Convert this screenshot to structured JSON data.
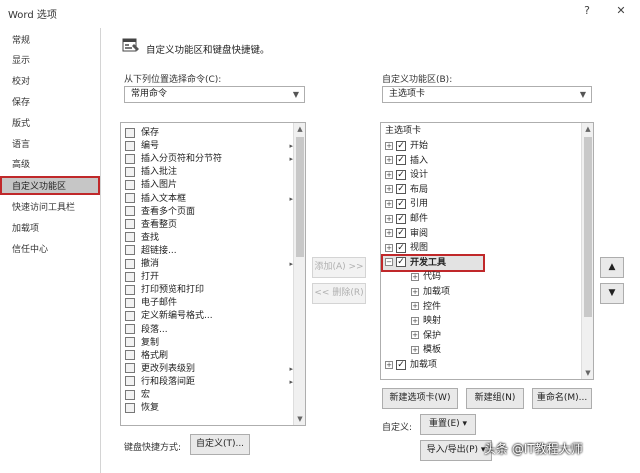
{
  "window": {
    "title": "Word 选项",
    "help_glyph": "?",
    "close_glyph": "✕"
  },
  "sidebar": {
    "items": [
      {
        "label": "常规"
      },
      {
        "label": "显示"
      },
      {
        "label": "校对"
      },
      {
        "label": "保存"
      },
      {
        "label": "版式"
      },
      {
        "label": "语言"
      },
      {
        "label": "高级"
      },
      {
        "label": "自定义功能区"
      },
      {
        "label": "快速访问工具栏"
      },
      {
        "label": "加载项"
      },
      {
        "label": "信任中心"
      }
    ]
  },
  "header": {
    "title": "自定义功能区和键盘快捷键。"
  },
  "left_panel": {
    "choose_label": "从下列位置选择命令(C):",
    "choose_value": "常用命令",
    "commands": [
      {
        "label": "保存",
        "sub": ""
      },
      {
        "label": "编号",
        "sub": "▸"
      },
      {
        "label": "插入分页符和分节符",
        "sub": "▸"
      },
      {
        "label": "插入批注",
        "sub": ""
      },
      {
        "label": "插入图片",
        "sub": ""
      },
      {
        "label": "插入文本框",
        "sub": "▸"
      },
      {
        "label": "查看多个页面",
        "sub": ""
      },
      {
        "label": "查看整页",
        "sub": ""
      },
      {
        "label": "查找",
        "sub": ""
      },
      {
        "label": "超链接...",
        "sub": ""
      },
      {
        "label": "撤消",
        "sub": "▸"
      },
      {
        "label": "打开",
        "sub": ""
      },
      {
        "label": "打印预览和打印",
        "sub": ""
      },
      {
        "label": "电子邮件",
        "sub": ""
      },
      {
        "label": "定义新编号格式...",
        "sub": ""
      },
      {
        "label": "段落...",
        "sub": ""
      },
      {
        "label": "复制",
        "sub": ""
      },
      {
        "label": "格式刷",
        "sub": ""
      },
      {
        "label": "更改列表级别",
        "sub": "▸"
      },
      {
        "label": "行和段落间距",
        "sub": "▸"
      },
      {
        "label": "宏",
        "sub": ""
      },
      {
        "label": "恢复",
        "sub": ""
      }
    ],
    "shortcut_label": "键盘快捷方式:",
    "shortcut_button": "自定义(T)..."
  },
  "middle": {
    "add_button": "添加(A) >>",
    "remove_button": "<< 删除(R)"
  },
  "right_panel": {
    "ribbon_label": "自定义功能区(B):",
    "ribbon_value": "主选项卡",
    "tree_header": "主选项卡",
    "tree": [
      {
        "level": 0,
        "exp": "⊞",
        "checked": true,
        "label": "开始"
      },
      {
        "level": 0,
        "exp": "⊞",
        "checked": true,
        "label": "插入"
      },
      {
        "level": 0,
        "exp": "⊞",
        "checked": true,
        "label": "设计"
      },
      {
        "level": 0,
        "exp": "⊞",
        "checked": true,
        "label": "布局"
      },
      {
        "level": 0,
        "exp": "⊞",
        "checked": true,
        "label": "引用"
      },
      {
        "level": 0,
        "exp": "⊞",
        "checked": true,
        "label": "邮件"
      },
      {
        "level": 0,
        "exp": "⊞",
        "checked": true,
        "label": "审阅"
      },
      {
        "level": 0,
        "exp": "⊞",
        "checked": true,
        "label": "视图"
      },
      {
        "level": 0,
        "exp": "⊟",
        "checked": true,
        "label": "开发工具"
      },
      {
        "level": 1,
        "exp": "⊞",
        "checked": false,
        "label": "代码"
      },
      {
        "level": 1,
        "exp": "⊞",
        "checked": false,
        "label": "加载项"
      },
      {
        "level": 1,
        "exp": "⊞",
        "checked": false,
        "label": "控件"
      },
      {
        "level": 1,
        "exp": "⊞",
        "checked": false,
        "label": "映射"
      },
      {
        "level": 1,
        "exp": "⊞",
        "checked": false,
        "label": "保护"
      },
      {
        "level": 1,
        "exp": "⊞",
        "checked": false,
        "label": "模板"
      },
      {
        "level": 0,
        "exp": "⊞",
        "checked": true,
        "label": "加载项"
      }
    ],
    "new_tab_button": "新建选项卡(W)",
    "new_group_button": "新建组(N)",
    "rename_button": "重命名(M)...",
    "customize_label": "自定义:",
    "reset_button": "重置(E) ▾",
    "import_export_button": "导入/导出(P) ▾",
    "move_up": "▲",
    "move_down": "▼"
  },
  "watermark": "头条 @IT教程大师",
  "colors": {
    "accent_red": "#c0282a",
    "selected_bg": "#c6c6c6"
  }
}
